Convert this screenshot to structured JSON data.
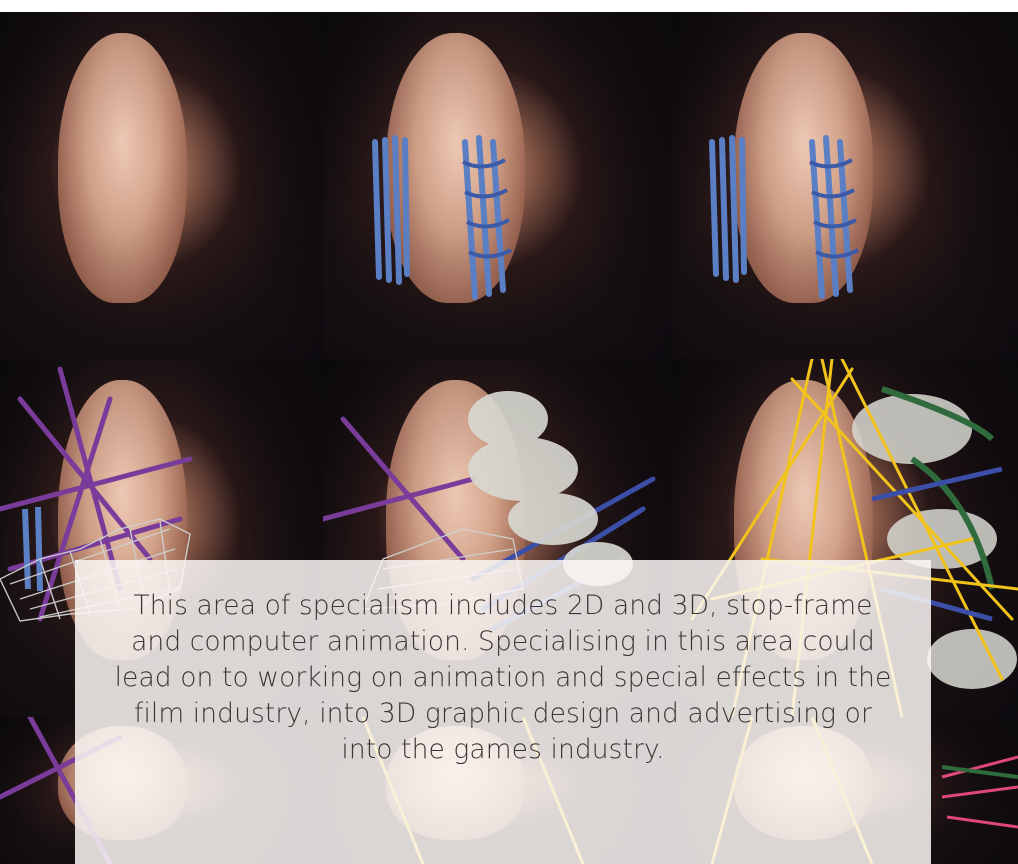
{
  "gallery": {
    "tiles": [
      {
        "name": "portrait-plain",
        "accents": []
      },
      {
        "name": "portrait-blue-weave",
        "accents": [
          "#5b7fc4"
        ]
      },
      {
        "name": "portrait-blue-weave-2",
        "accents": [
          "#5b7fc4"
        ]
      },
      {
        "name": "portrait-purple-sticks-mesh",
        "accents": [
          "#7a3c9a",
          "#c9c9c9"
        ]
      },
      {
        "name": "portrait-wool-sticks",
        "accents": [
          "#d9d9d2",
          "#3c4fa8"
        ]
      },
      {
        "name": "portrait-yellow-threads",
        "accents": [
          "#f2c31b",
          "#2f6b3c"
        ]
      },
      {
        "name": "portrait-bottom-1",
        "accents": [
          "#7a3c9a"
        ]
      },
      {
        "name": "portrait-bottom-2",
        "accents": [
          "#f2c31b"
        ]
      },
      {
        "name": "portrait-bottom-3",
        "accents": [
          "#e0487a",
          "#2f6b3c"
        ]
      }
    ]
  },
  "overlay": {
    "text": "This area of specialism includes 2D and 3D, stop-frame and computer animation. Specialising in this area could lead on to working on animation and special effects in the film industry, into 3D graphic design and advertising or into the games industry."
  },
  "colors": {
    "overlay_bg": "#faf7f4",
    "text": "#3a3533"
  }
}
